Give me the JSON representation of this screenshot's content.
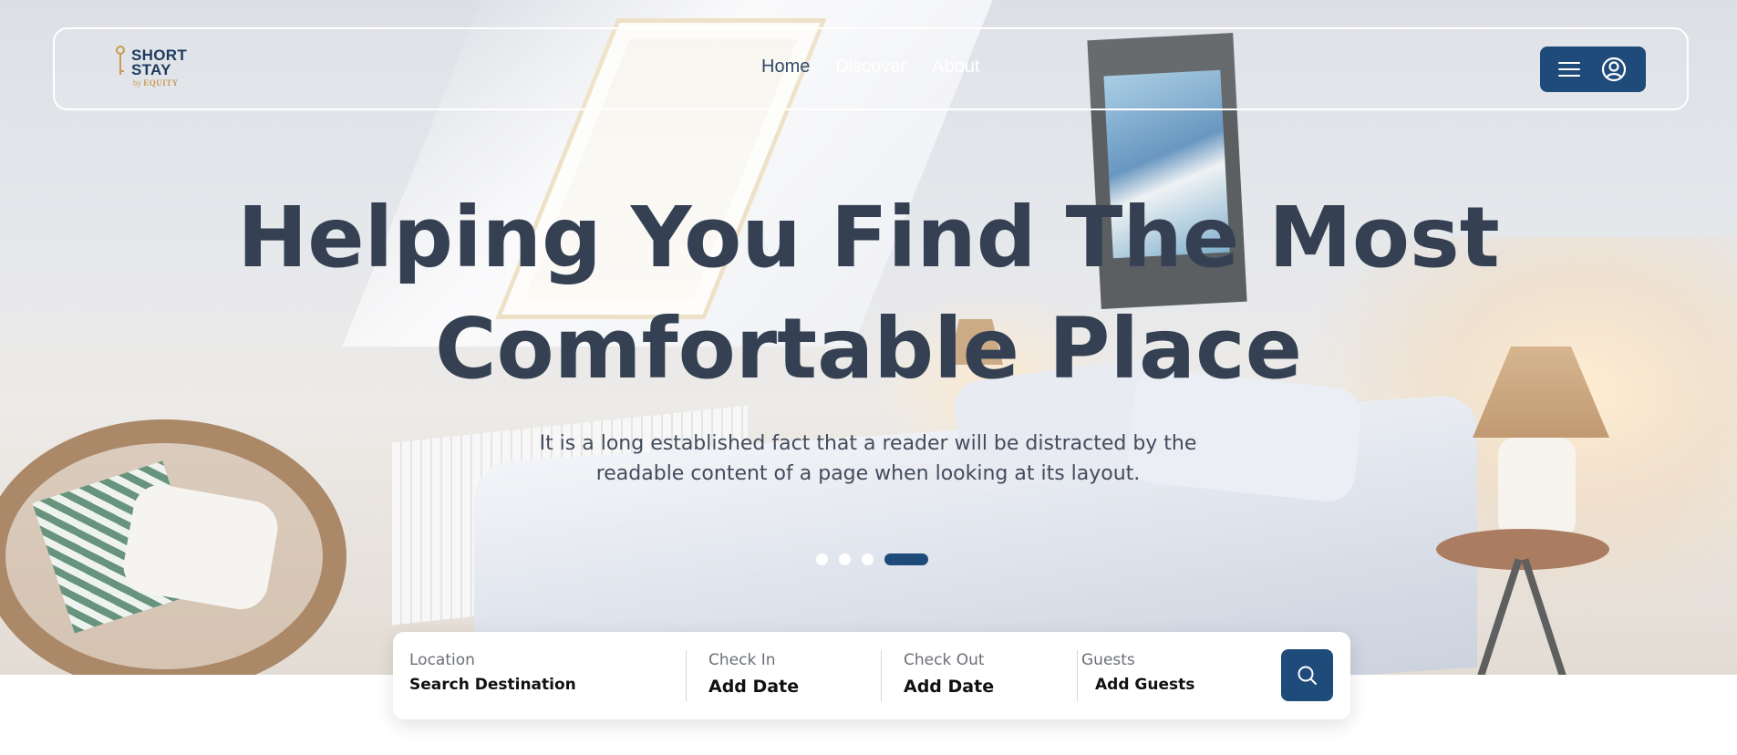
{
  "brand": {
    "name_line1": "SHORT",
    "name_line2": "STAY",
    "by": "by",
    "parent": "EQUITY"
  },
  "nav": {
    "links": [
      {
        "label": "Home",
        "active": true
      },
      {
        "label": "Discover",
        "active": false
      },
      {
        "label": "About",
        "active": false
      }
    ],
    "menu_icon": "hamburger-menu-icon",
    "user_icon": "user-circle-icon"
  },
  "hero": {
    "title_line1": "Helping You Find The Most",
    "title_line2": "Comfortable Place",
    "subtitle": "It is a long established fact that a reader will be distracted by the readable content of a page when looking at its layout."
  },
  "carousel": {
    "slides": 4,
    "active_index": 3
  },
  "search": {
    "location": {
      "label": "Location",
      "value": "Search Destination"
    },
    "check_in": {
      "label": "Check In",
      "value": "Add Date"
    },
    "check_out": {
      "label": "Check Out",
      "value": "Add Date"
    },
    "guests": {
      "label": "Guests",
      "value": "Add Guests"
    },
    "button_icon": "search-icon"
  },
  "colors": {
    "primary": "#1f4b7a",
    "title_text": "#354153",
    "brand_gold": "#c89a52",
    "brand_navy": "#1e3a5f"
  }
}
